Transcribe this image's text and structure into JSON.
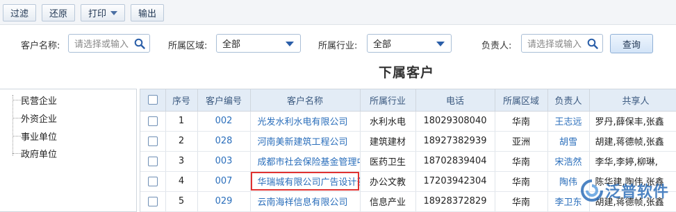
{
  "toolbar": {
    "filter_label": "过滤",
    "restore_label": "还原",
    "print_label": "打印",
    "export_label": "输出"
  },
  "filters": {
    "customer_name_label": "客户名称:",
    "customer_name_placeholder": "请选择或输入",
    "region_label": "所属区域:",
    "region_value": "全部",
    "industry_label": "所属行业:",
    "industry_value": "全部",
    "owner_label": "负责人:",
    "owner_placeholder": "请选择或输入",
    "query_label": "查询"
  },
  "page_title": "下属客户",
  "tree": {
    "items": [
      {
        "label": "民营企业"
      },
      {
        "label": "外资企业"
      },
      {
        "label": "事业单位"
      },
      {
        "label": "政府单位"
      }
    ]
  },
  "grid": {
    "headers": {
      "index": "序号",
      "code": "客户编号",
      "name": "客户名称",
      "industry": "所属行业",
      "phone": "电话",
      "region": "所属区域",
      "owner": "负责人",
      "shared": "共享人"
    },
    "rows": [
      {
        "index": "1",
        "code": "002",
        "name": "光发水利水电有限公司",
        "industry": "水利水电",
        "phone": "18029308040",
        "region": "华南",
        "owner": "王志远",
        "shared": "罗丹,薛保丰,张鑫"
      },
      {
        "index": "2",
        "code": "028",
        "name": "河南美新建筑工程公司",
        "industry": "建筑建材",
        "phone": "18927382939",
        "region": "亚洲",
        "owner": "胡雪",
        "shared": "胡建,蒋德帧,张鑫"
      },
      {
        "index": "3",
        "code": "003",
        "name": "成都市社会保险基金管理中心",
        "industry": "医药卫生",
        "phone": "18702839404",
        "region": "华南",
        "owner": "宋浩然",
        "shared": "李华,李婷,柳琳,"
      },
      {
        "index": "4",
        "code": "007",
        "name": "华瑞城有限公司广告设计部",
        "industry": "办公文教",
        "phone": "17203942304",
        "region": "华南",
        "owner": "陶伟",
        "shared": "陈华建,陶伟,张鑫"
      },
      {
        "index": "5",
        "code": "029",
        "name": "云南海祥信息有限公司",
        "industry": "信息产业",
        "phone": "18928372829",
        "region": "华南",
        "owner": "李卫东",
        "shared": "胡建,蒋德帧,张鑫"
      }
    ]
  },
  "watermark": {
    "text": "泛普软件"
  },
  "colors": {
    "link": "#2a6ebb",
    "header_bg": "#e3ecf6",
    "highlight": "#e03131"
  }
}
